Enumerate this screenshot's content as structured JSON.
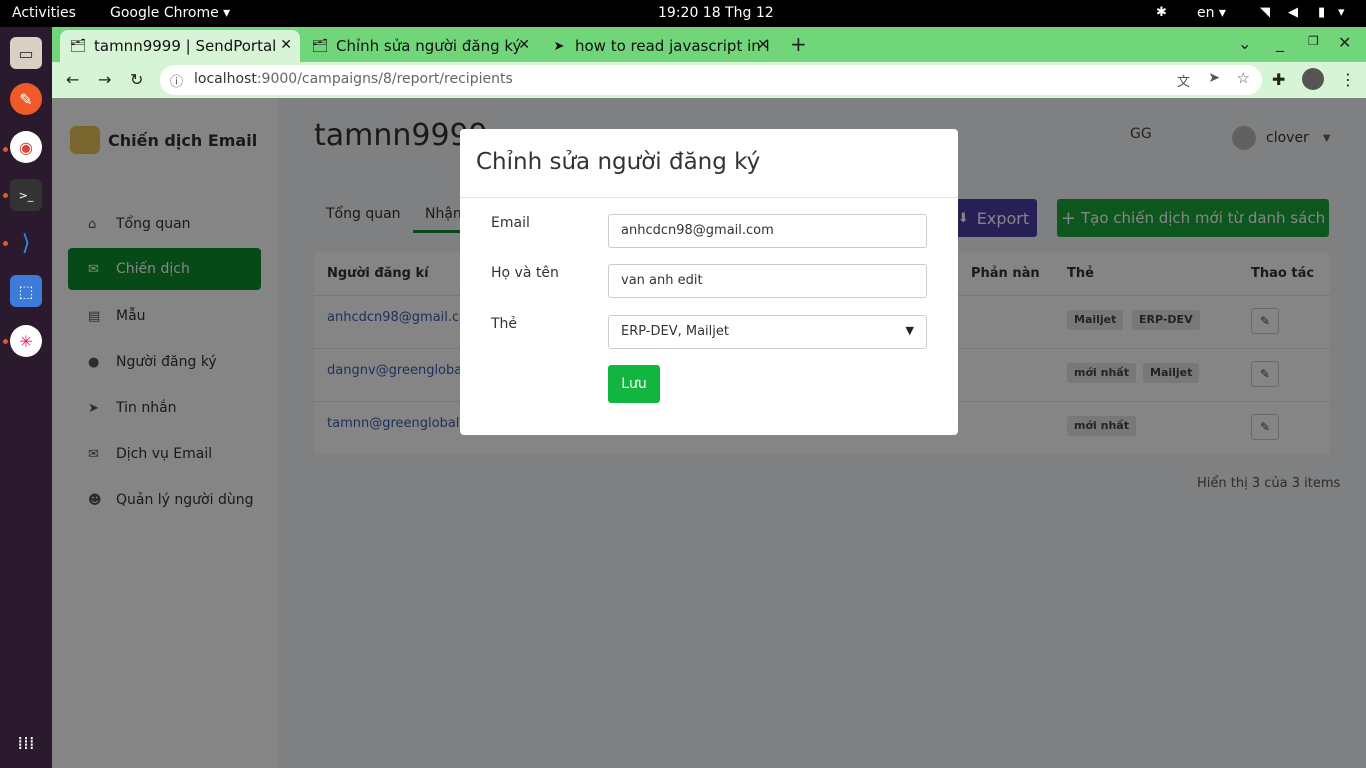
{
  "os": {
    "activities": "Activities",
    "app_menu": "Google Chrome ▾",
    "clock": "19:20  18 Thg 12",
    "lang": "en ▾"
  },
  "browser": {
    "tabs": [
      {
        "label": "tamnn9999 | SendPortal"
      },
      {
        "label": "Chỉnh sửa người đăng ký"
      },
      {
        "label": "how to read javascript in l"
      }
    ],
    "url_host": "localhost",
    "url_rest": ":9000/campaigns/8/report/recipients"
  },
  "sidebar": {
    "brand": "Chiến dịch Email",
    "items": [
      {
        "label": "Tổng quan"
      },
      {
        "label": "Chiến dịch"
      },
      {
        "label": "Mẫu"
      },
      {
        "label": "Người đăng ký"
      },
      {
        "label": "Tin nhắn"
      },
      {
        "label": "Dịch vụ Email"
      },
      {
        "label": "Quản lý người dùng"
      }
    ]
  },
  "header": {
    "title": "tamnn9999",
    "workspace": "GG",
    "user": "clover"
  },
  "subtabs": [
    "Tổng quan",
    "Nhận"
  ],
  "actions": {
    "export": "Export",
    "create": "Tạo chiến dịch mới từ danh sách"
  },
  "table": {
    "headers": [
      "Người đăng kí",
      "Phản nàn",
      "Thẻ",
      "Thao tác"
    ],
    "rows": [
      {
        "email": "anhcdcn98@gmail.com",
        "tags": [
          "Mailjet",
          "ERP-DEV"
        ]
      },
      {
        "email": "dangnv@greenglobal.vn",
        "tags": [
          "mới nhất",
          "Mailjet"
        ]
      },
      {
        "email": "tamnn@greenglobal.vn",
        "tags": [
          "mới nhất"
        ]
      }
    ],
    "pager": "Hiển thị 3 của 3 items"
  },
  "modal": {
    "title": "Chỉnh sửa người đăng ký",
    "email_label": "Email",
    "email_value": "anhcdcn98@gmail.com",
    "name_label": "Họ và tên",
    "name_value": "van anh edit",
    "tags_label": "Thẻ",
    "tags_value": "ERP-DEV, Mailjet",
    "save": "Lưu"
  },
  "colors": {
    "primary": "#0a8f2c",
    "export": "#4b3fa8",
    "save": "#13b541"
  }
}
